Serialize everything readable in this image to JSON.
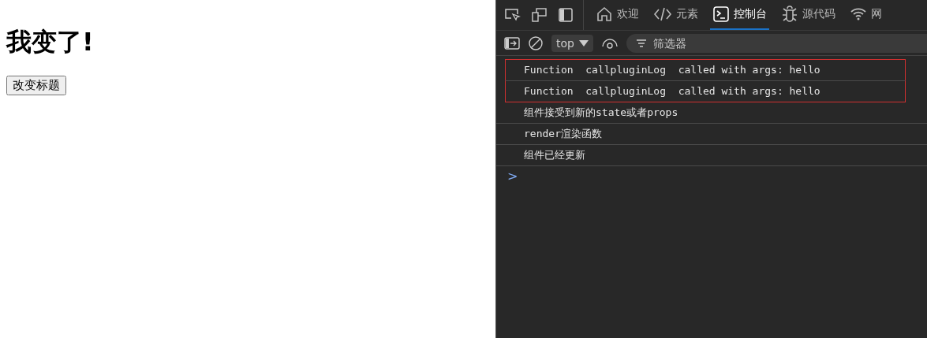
{
  "page": {
    "heading": "我变了!",
    "button": "改变标题"
  },
  "devtools": {
    "tabs": [
      {
        "kind": "home",
        "label": "欢迎",
        "selected": false
      },
      {
        "kind": "code",
        "label": "元素",
        "selected": false
      },
      {
        "kind": "console",
        "label": "控制台",
        "selected": true
      },
      {
        "kind": "bug",
        "label": "源代码",
        "selected": false
      },
      {
        "kind": "wifi",
        "label": "网",
        "selected": false
      }
    ],
    "context": "top",
    "filter": {
      "placeholder": "筛选器"
    },
    "logs": [
      {
        "text": "Function  callpluginLog  called with args: hello",
        "highlighted": true
      },
      {
        "text": "Function  callpluginLog  called with args: hello",
        "highlighted": true
      },
      {
        "text": "组件接受到新的state或者props",
        "highlighted": false
      },
      {
        "text": "render渲染函数",
        "highlighted": false
      },
      {
        "text": "组件已经更新",
        "highlighted": false
      }
    ],
    "prompt": ">"
  }
}
